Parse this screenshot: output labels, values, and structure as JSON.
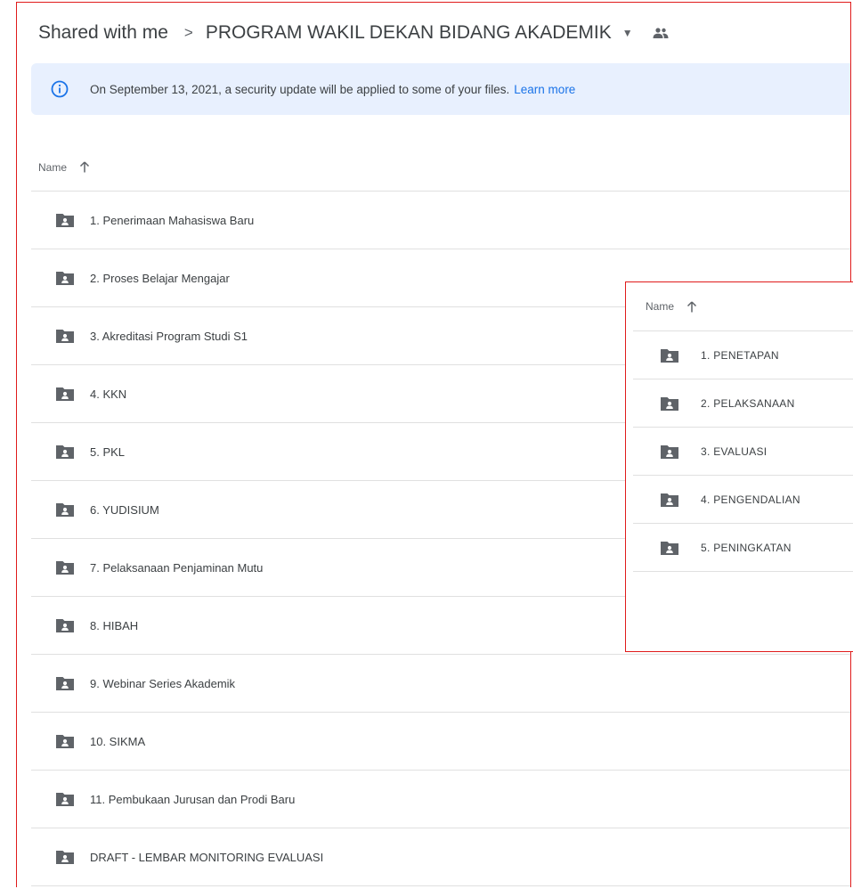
{
  "breadcrumb": {
    "root": "Shared with me",
    "separator": ">",
    "current": "PROGRAM WAKIL DEKAN BIDANG AKADEMIK",
    "caret_icon": "caret-down-icon",
    "shared_icon": "people-icon"
  },
  "banner": {
    "icon": "info-icon",
    "text": "On September 13, 2021, a security update will be applied to some of your files.",
    "link": "Learn more"
  },
  "main_list": {
    "header": {
      "label": "Name",
      "sort_icon": "arrow-up-icon"
    },
    "items": [
      {
        "name": "1. Penerimaan Mahasiswa Baru",
        "icon": "shared-folder-icon"
      },
      {
        "name": "2. Proses Belajar Mengajar",
        "icon": "shared-folder-icon"
      },
      {
        "name": "3. Akreditasi Program Studi S1",
        "icon": "shared-folder-icon"
      },
      {
        "name": "4. KKN",
        "icon": "shared-folder-icon"
      },
      {
        "name": "5. PKL",
        "icon": "shared-folder-icon"
      },
      {
        "name": "6. YUDISIUM",
        "icon": "shared-folder-icon"
      },
      {
        "name": "7. Pelaksanaan Penjaminan Mutu",
        "icon": "shared-folder-icon"
      },
      {
        "name": "8. HIBAH",
        "icon": "shared-folder-icon"
      },
      {
        "name": "9. Webinar Series Akademik",
        "icon": "shared-folder-icon"
      },
      {
        "name": "10. SIKMA",
        "icon": "shared-folder-icon"
      },
      {
        "name": "11. Pembukaan Jurusan dan Prodi Baru",
        "icon": "shared-folder-icon"
      },
      {
        "name": "DRAFT - LEMBAR MONITORING EVALUASI",
        "icon": "shared-folder-icon"
      }
    ]
  },
  "subfolder_panel": {
    "header": {
      "label": "Name",
      "sort_icon": "arrow-up-icon"
    },
    "items": [
      {
        "name": "1. PENETAPAN",
        "icon": "shared-folder-icon"
      },
      {
        "name": "2. PELAKSANAAN",
        "icon": "shared-folder-icon"
      },
      {
        "name": "3. EVALUASI",
        "icon": "shared-folder-icon"
      },
      {
        "name": "4. PENGENDALIAN",
        "icon": "shared-folder-icon"
      },
      {
        "name": "5. PENINGKATAN",
        "icon": "shared-folder-icon"
      }
    ]
  },
  "colors": {
    "highlight_border": "#e01b1b",
    "banner_bg": "#e8f0fe",
    "link": "#1a73e8",
    "folder": "#5f6368",
    "text": "#3c4043"
  }
}
